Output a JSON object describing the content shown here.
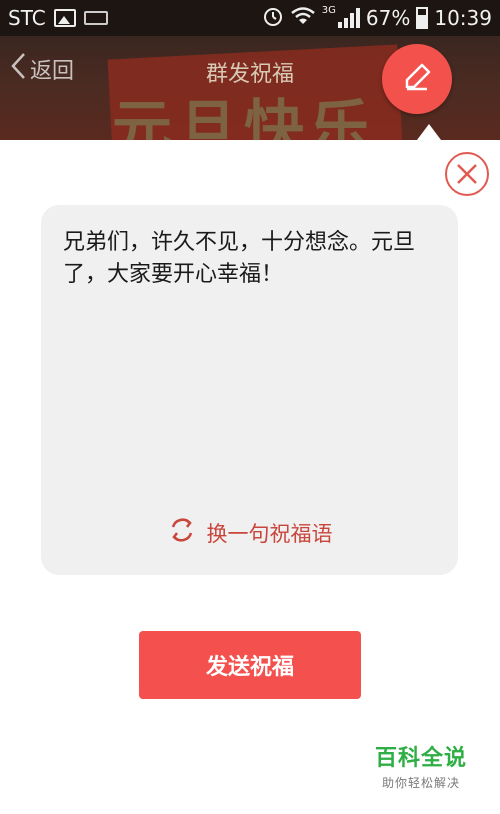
{
  "status_bar": {
    "carrier": "STC",
    "network": "3G",
    "battery": "67%",
    "time": "10:39"
  },
  "header": {
    "back_label": "返回",
    "title": "群发祝福",
    "banner_text": "元旦快乐"
  },
  "card": {
    "message": "兄弟们，许久不见，十分想念。元旦了，大家要开心幸福！",
    "change_label": "换一句祝福语"
  },
  "send_label": "发送祝福",
  "watermark": {
    "title": "百科全说",
    "subtitle": "助你轻松解决"
  },
  "colors": {
    "accent": "#f4514e",
    "accent_text": "#c9463d",
    "card_bg": "#f0f0f0",
    "watermark_green": "#2fae45"
  },
  "icons": {
    "back": "chevron-left-icon",
    "pen": "pen-icon",
    "close": "close-circle-icon",
    "refresh": "refresh-icon"
  }
}
